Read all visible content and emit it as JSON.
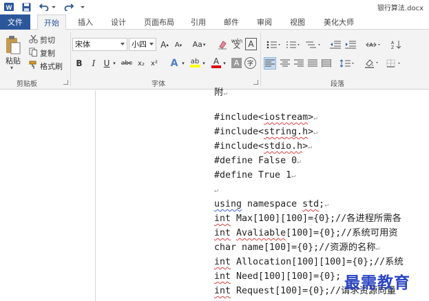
{
  "window": {
    "title": "银行算法.docx"
  },
  "tabs": {
    "file": "文件",
    "items": [
      {
        "label": "开始",
        "active": true
      },
      {
        "label": "插入",
        "active": false
      },
      {
        "label": "设计",
        "active": false
      },
      {
        "label": "页面布局",
        "active": false
      },
      {
        "label": "引用",
        "active": false
      },
      {
        "label": "邮件",
        "active": false
      },
      {
        "label": "审阅",
        "active": false
      },
      {
        "label": "视图",
        "active": false
      },
      {
        "label": "美化大师",
        "active": false
      }
    ]
  },
  "clipboard": {
    "paste": "粘贴",
    "cut": "剪切",
    "copy": "复制",
    "format_painter": "格式刷",
    "group_label": "剪贴板"
  },
  "font": {
    "name": "宋体",
    "size": "小四",
    "grow": "A",
    "shrink": "A",
    "case": "Aa",
    "phonetic": "wén",
    "border_char": "A",
    "bold": "B",
    "italic": "I",
    "underline": "U",
    "strike": "abc",
    "subscript": "x₂",
    "superscript": "x²",
    "effects": "A",
    "highlight": "ab",
    "color": "A",
    "shading": "A",
    "enclose": "字",
    "group_label": "字体"
  },
  "paragraph": {
    "group_label": "段落"
  },
  "colors": {
    "file_tab": "#2b579a",
    "active_tab_text": "#2b579a",
    "ribbon_bg": "#f3f3f3",
    "highlight_yellow": "#ffff00",
    "font_red": "#e00000",
    "watermark": "#2c45c4"
  },
  "document": {
    "lines": [
      {
        "text": "附",
        "mark": "↵"
      },
      {
        "text": "",
        "mark": ""
      },
      {
        "pre": "#include<",
        "sq": "iostream",
        "post": ">",
        "mark": "↵"
      },
      {
        "pre": "#include<",
        "sq": "string.h",
        "post": ">",
        "mark": "↵"
      },
      {
        "pre": "#include<",
        "sq": "stdio.h",
        "post": ">",
        "mark": "↵"
      },
      {
        "text": "#define False 0",
        "mark": "↵"
      },
      {
        "text": "#define True 1",
        "mark": "↵"
      },
      {
        "text": "",
        "mark": "↵"
      },
      {
        "sq": "using",
        "post": " namespace ",
        "sq2": "std",
        "post2": ";",
        "mark": "↵"
      },
      {
        "sq": "int",
        "post": " Max[100][100]={0};//各进程所需各",
        "mark": ""
      },
      {
        "sq": "int",
        "post": " ",
        "sq2": "Avaliable",
        "post2": "[100]={0};//系统可用资",
        "mark": ""
      },
      {
        "text": "char name[100]={0};//资源的名称",
        "mark": "↵"
      },
      {
        "sq": "int",
        "post": " Allocation[100][100]={0};//系统",
        "mark": ""
      },
      {
        "sq": "int",
        "post": " Need[100][100]={0};",
        "mark": ""
      },
      {
        "sq": "int",
        "post": " Request[100]={0};//请求资源向量",
        "mark": ""
      }
    ]
  },
  "watermark": "最需教育"
}
